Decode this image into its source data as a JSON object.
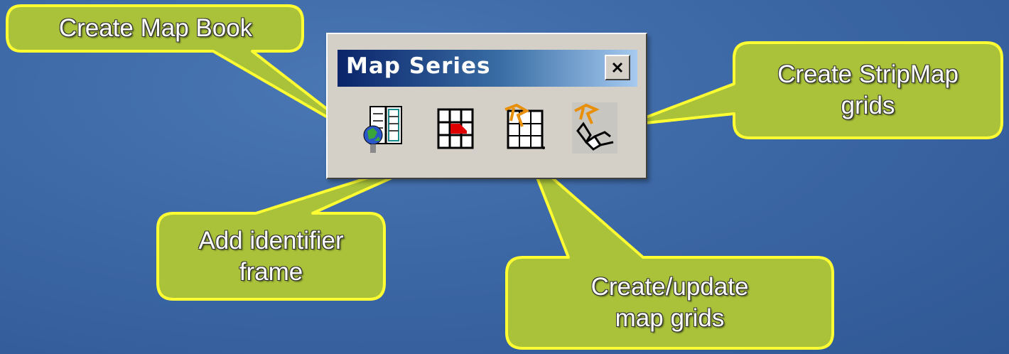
{
  "toolbar": {
    "title": "Map Series",
    "close_glyph": "x-icon",
    "buttons": [
      {
        "icon": "map-book-icon",
        "tooltip": "Create Map Book"
      },
      {
        "icon": "identifier-frame-icon",
        "tooltip": "Add identifier frame"
      },
      {
        "icon": "map-grid-icon",
        "tooltip": "Create/update map grids"
      },
      {
        "icon": "stripmap-grid-icon",
        "tooltip": "Create StripMap grids"
      }
    ]
  },
  "callouts": {
    "create_map_book": "Create Map Book",
    "add_identifier_frame": "Add identifier\nframe",
    "create_update_map_grids": "Create/update\nmap grids",
    "create_stripmap_grids": "Create StripMap\ngrids"
  },
  "colors": {
    "callout_fill": "#a9c23a",
    "callout_border": "#ffff33",
    "title_start": "#0a246a",
    "title_end": "#a6caf0",
    "toolbar_face": "#d4d0c8"
  }
}
